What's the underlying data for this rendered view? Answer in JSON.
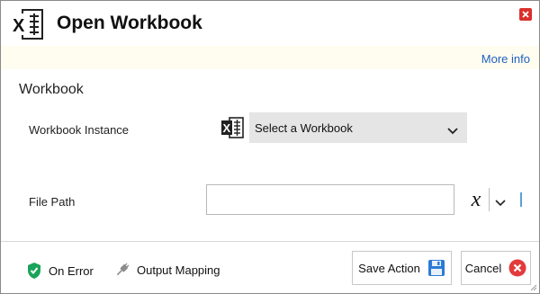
{
  "dialog": {
    "title": "Open Workbook",
    "more_info": "More info",
    "section_title": "Workbook",
    "workbook_instance": {
      "label": "Workbook Instance",
      "selected": "Select a Workbook"
    },
    "file_path": {
      "label": "File Path",
      "value": "",
      "placeholder": ""
    }
  },
  "footer": {
    "on_error": "On Error",
    "output_mapping": "Output Mapping",
    "save": "Save Action",
    "cancel": "Cancel"
  },
  "colors": {
    "accent_link": "#1f5fbf",
    "close_red": "#d9302c",
    "shield_green": "#1aa35a",
    "save_blue": "#2b7bd6",
    "info_strip": "#fffdf0"
  },
  "icons": {
    "header": "excel-icon",
    "close": "close-icon",
    "workbook": "excel-icon",
    "chevron": "chevron-down-icon",
    "fx": "variable-x-icon",
    "on_error": "shield-check-icon",
    "output_mapping": "plug-icon",
    "save": "floppy-disk-icon",
    "cancel": "cancel-circle-icon"
  }
}
